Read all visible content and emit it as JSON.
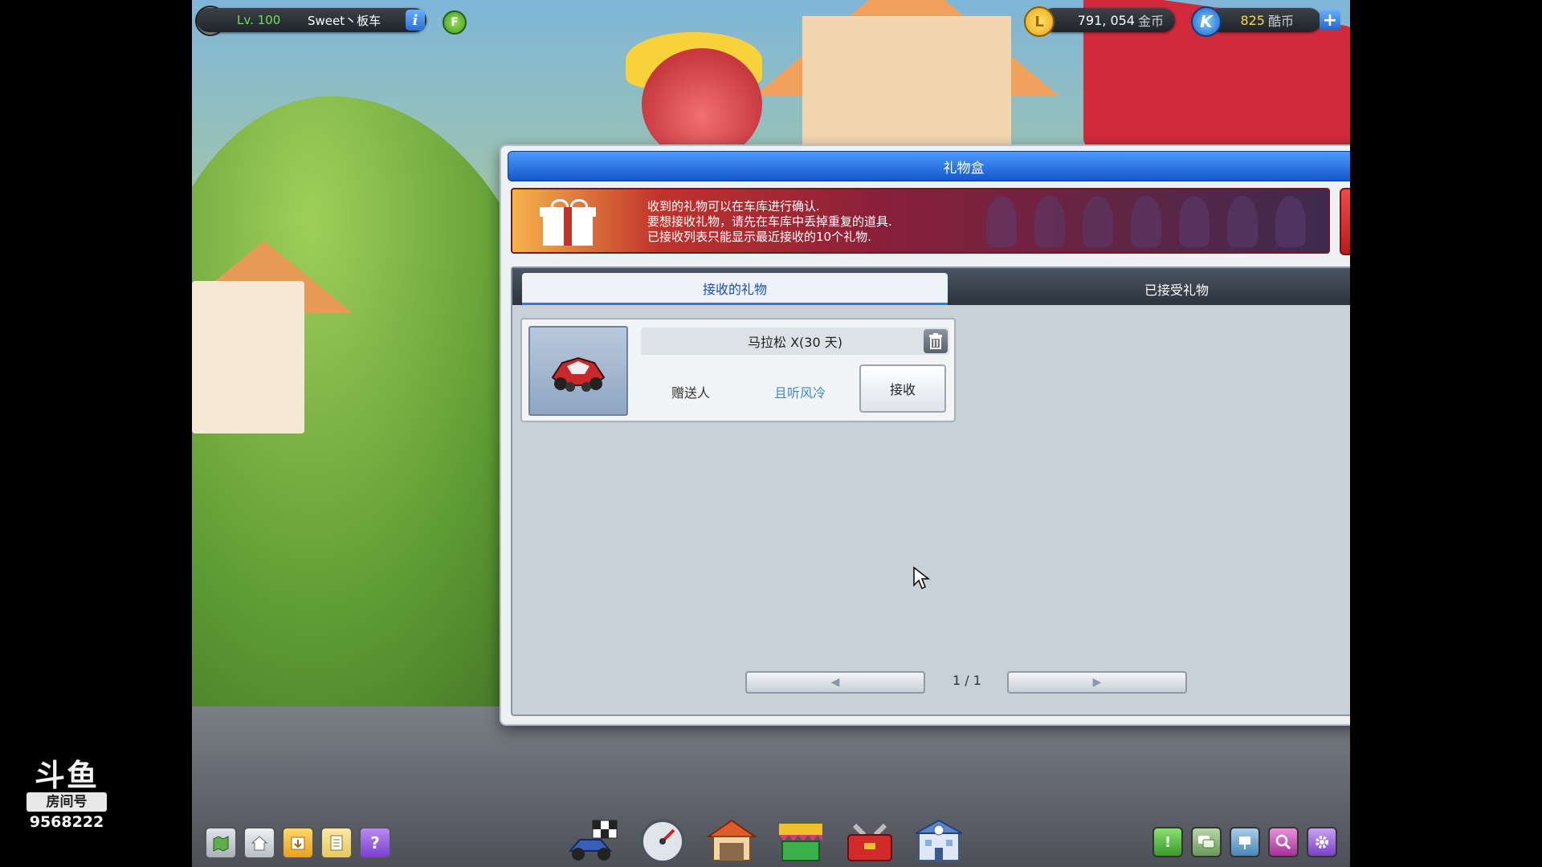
{
  "hud": {
    "level": "Lv. 100",
    "player_name": "Sweet丶板车",
    "gold_amount": "791, 054",
    "gold_unit": "金币",
    "k_amount": "825",
    "k_unit": "酷币",
    "info_glyph": "i",
    "f_glyph": "F",
    "gold_glyph": "L",
    "k_glyph": "K",
    "plus_glyph": "+"
  },
  "dialog": {
    "title": "礼物盒",
    "notice_lines": [
      "收到的礼物可以在车库进行确认.",
      "要想接收礼物，请先在车库中丢掉重复的道具.",
      "已接收列表只能显示最近接收的10个礼物."
    ],
    "tabs": [
      {
        "label": "接收的礼物",
        "active": true
      },
      {
        "label": "已接受礼物",
        "active": false
      }
    ],
    "gifts": [
      {
        "item_name": "马拉松 Ⅹ(30 天)",
        "sender_label": "赠送人",
        "sender_name": "且听风冷",
        "accept_label": "接收",
        "icon": "kart-icon"
      }
    ],
    "pagination": {
      "current": "1",
      "separator": "/",
      "total": "1",
      "prev_glyph": "◀",
      "next_glyph": "▶"
    }
  },
  "toolbar_left": [
    {
      "icon": "map-icon",
      "color": "#c9cfd4"
    },
    {
      "icon": "home-icon",
      "color": "#d8dde2"
    },
    {
      "icon": "download-icon",
      "color": "#f3c24a"
    },
    {
      "icon": "notes-icon",
      "color": "#f0d47a"
    },
    {
      "icon": "help-icon",
      "glyph": "?",
      "color": "#9b5ce0"
    }
  ],
  "toolbar_center": [
    {
      "icon": "kart-race-icon",
      "color": "#5a7dc8"
    },
    {
      "icon": "speedometer-icon",
      "color": "#9aa6b4"
    },
    {
      "icon": "garage-icon",
      "color": "#e0743a"
    },
    {
      "icon": "shop-icon",
      "color": "#e05a8a"
    },
    {
      "icon": "toolbox-icon",
      "color": "#d23030"
    },
    {
      "icon": "club-building-icon",
      "color": "#6a8fd8"
    }
  ],
  "toolbar_right": [
    {
      "icon": "alert-icon",
      "glyph": "!",
      "color": "#52b84a"
    },
    {
      "icon": "chat-icon",
      "color": "#7ab86a"
    },
    {
      "icon": "mailbox-icon",
      "color": "#6aa0c8"
    },
    {
      "icon": "search-icon",
      "color": "#c050b0"
    },
    {
      "icon": "settings-icon",
      "color": "#a060d0"
    }
  ],
  "watermark": {
    "logo": "斗鱼",
    "room_label": "房间号",
    "room_number": "9568222"
  }
}
